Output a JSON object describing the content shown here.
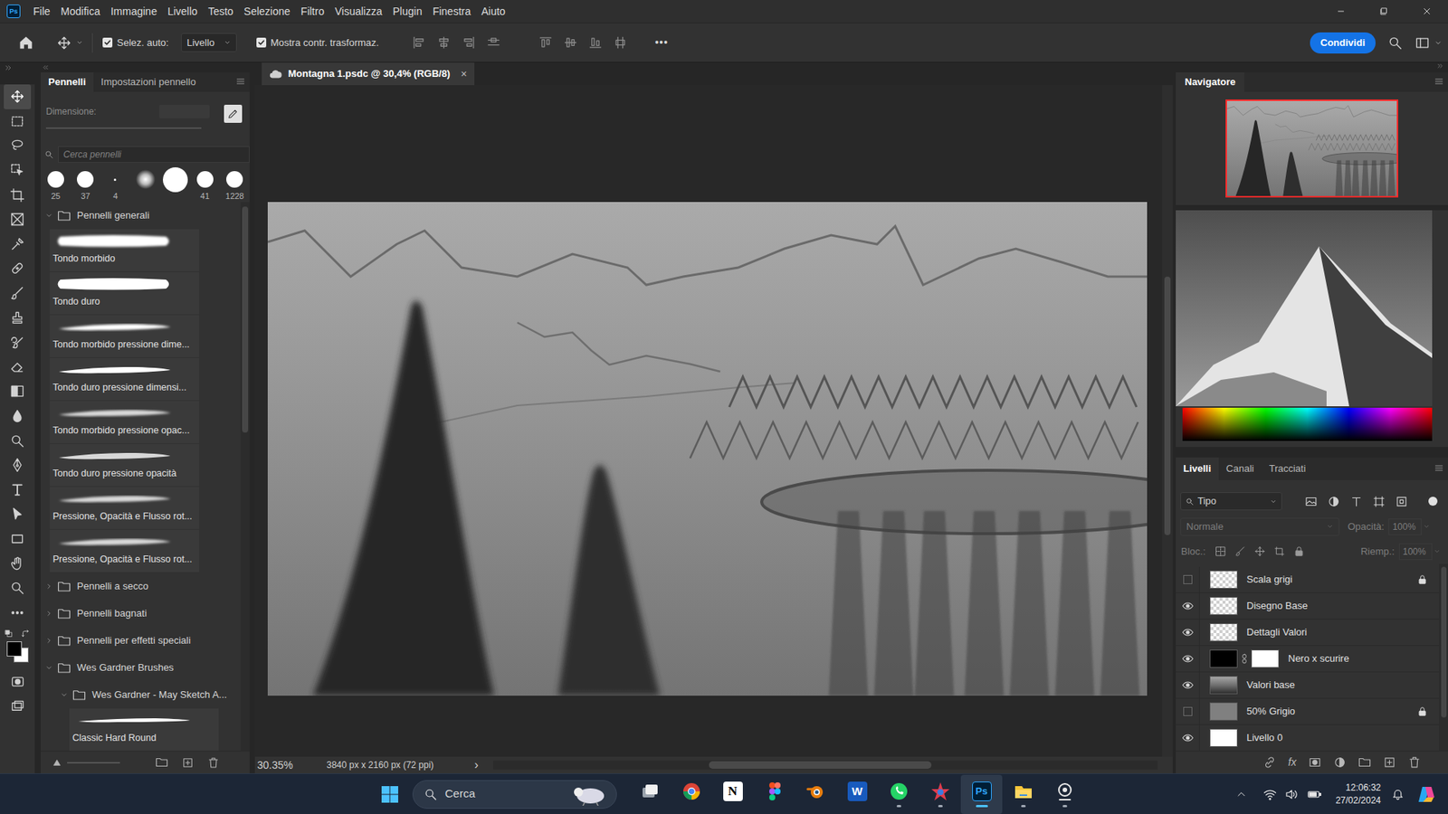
{
  "app": {
    "logo": "Ps"
  },
  "menu": [
    "File",
    "Modifica",
    "Immagine",
    "Livello",
    "Testo",
    "Selezione",
    "Filtro",
    "Visualizza",
    "Plugin",
    "Finestra",
    "Aiuto"
  ],
  "options_bar": {
    "auto_select": {
      "label": "Selez. auto:",
      "checked": true
    },
    "target": "Livello",
    "show_transform": {
      "label": "Mostra contr. trasformaz.",
      "checked": true
    },
    "more": "•••",
    "share": "Condividi"
  },
  "tools": [
    {
      "kind": "move",
      "selected": true
    },
    {
      "kind": "marquee",
      "selected": false
    },
    {
      "kind": "lasso",
      "selected": false
    },
    {
      "kind": "objselect",
      "selected": false
    },
    {
      "kind": "crop",
      "selected": false
    },
    {
      "kind": "frame",
      "selected": false
    },
    {
      "kind": "eyedropper",
      "selected": false
    },
    {
      "kind": "heal",
      "selected": false
    },
    {
      "kind": "brush",
      "selected": false
    },
    {
      "kind": "stamp",
      "selected": false
    },
    {
      "kind": "historybrush",
      "selected": false
    },
    {
      "kind": "eraser",
      "selected": false
    },
    {
      "kind": "gradient",
      "selected": false
    },
    {
      "kind": "blur",
      "selected": false
    },
    {
      "kind": "dodge",
      "selected": false
    },
    {
      "kind": "pen",
      "selected": false
    },
    {
      "kind": "type",
      "selected": false
    },
    {
      "kind": "pathselect",
      "selected": false
    },
    {
      "kind": "rect",
      "selected": false
    },
    {
      "kind": "hand",
      "selected": false
    },
    {
      "kind": "zoom",
      "selected": false
    },
    {
      "kind": "more",
      "selected": false
    }
  ],
  "brushes_panel": {
    "tabs": [
      {
        "label": "Pennelli",
        "selected": true
      },
      {
        "label": "Impostazioni pennello",
        "selected": false
      }
    ],
    "size_label": "Dimensione:",
    "search_placeholder": "Cerca pennelli",
    "presets": [
      {
        "size": "25",
        "kind": "hard"
      },
      {
        "size": "37",
        "kind": "hard"
      },
      {
        "size": "4",
        "kind": "dot"
      },
      {
        "size": "",
        "kind": "soft"
      },
      {
        "size": "",
        "kind": "large"
      },
      {
        "size": "41",
        "kind": "hard"
      },
      {
        "size": "1228",
        "kind": "hard"
      }
    ],
    "tree": [
      {
        "kind": "folder",
        "name": "Pennelli generali",
        "expanded": true,
        "depth": 0
      },
      {
        "kind": "brush",
        "name": "Tondo morbido",
        "stroke": "soft",
        "depth": 1
      },
      {
        "kind": "brush",
        "name": "Tondo duro",
        "stroke": "hard",
        "depth": 1
      },
      {
        "kind": "brush",
        "name": "Tondo morbido pressione dime...",
        "stroke": "soft-taper",
        "depth": 1
      },
      {
        "kind": "brush",
        "name": "Tondo duro pressione dimensi...",
        "stroke": "hard-taper",
        "depth": 1
      },
      {
        "kind": "brush",
        "name": "Tondo morbido pressione opac...",
        "stroke": "soft-fade",
        "depth": 1
      },
      {
        "kind": "brush",
        "name": "Tondo duro pressione opacità",
        "stroke": "hard-fade",
        "depth": 1
      },
      {
        "kind": "brush",
        "name": "Pressione, Opacità e Flusso rot...",
        "stroke": "pressure",
        "depth": 1
      },
      {
        "kind": "brush",
        "name": "Pressione, Opacità e Flusso rot...",
        "stroke": "pressure",
        "depth": 1
      },
      {
        "kind": "folder",
        "name": "Pennelli a secco",
        "expanded": false,
        "depth": 0
      },
      {
        "kind": "folder",
        "name": "Pennelli bagnati",
        "expanded": false,
        "depth": 0
      },
      {
        "kind": "folder",
        "name": "Pennelli per effetti speciali",
        "expanded": false,
        "depth": 0
      },
      {
        "kind": "folder",
        "name": "Wes Gardner Brushes",
        "expanded": true,
        "depth": 0
      },
      {
        "kind": "folder",
        "name": "Wes Gardner - May Sketch A...",
        "expanded": true,
        "depth": 1
      },
      {
        "kind": "brush",
        "name": "Classic Hard Round",
        "stroke": "hard-thin",
        "depth": 2
      }
    ]
  },
  "document": {
    "tab": "Montagna 1.psdc @ 30,4% (RGB/8)",
    "close": "×",
    "zoom": "30.35%",
    "info": "3840 px x 2160 px (72 ppi)",
    "arrow": "›"
  },
  "navigator": {
    "title": "Navigatore"
  },
  "layers_panel": {
    "tabs": [
      {
        "label": "Livelli",
        "selected": true
      },
      {
        "label": "Canali",
        "selected": false
      },
      {
        "label": "Tracciati",
        "selected": false
      }
    ],
    "filter": "Tipo",
    "controls_disabled": true,
    "blend": "Normale",
    "opacity_label": "Opacità:",
    "opacity": "100%",
    "lock_label": "Bloc.:",
    "fill_label": "Riemp.:",
    "fill": "100%",
    "fx": "fx",
    "layers": [
      {
        "name": "Scala grigi",
        "visible": false,
        "locked": true,
        "kind": "transparent"
      },
      {
        "name": "Disegno Base",
        "visible": true,
        "locked": false,
        "kind": "transparent"
      },
      {
        "name": "Dettagli Valori",
        "visible": true,
        "locked": false,
        "kind": "transparent"
      },
      {
        "name": "Nero x scurire",
        "visible": true,
        "locked": false,
        "kind": "mask"
      },
      {
        "name": "Valori base",
        "visible": true,
        "locked": false,
        "kind": "image"
      },
      {
        "name": "50% Grigio",
        "visible": false,
        "locked": true,
        "kind": "gray"
      },
      {
        "name": "Livello 0",
        "visible": true,
        "locked": false,
        "kind": "white"
      }
    ]
  },
  "taskbar": {
    "search": "Cerca",
    "apps": [
      {
        "kind": "taskview",
        "label": "",
        "running": false,
        "active": false
      },
      {
        "kind": "chrome",
        "label": "",
        "running": false,
        "active": false
      },
      {
        "kind": "notion",
        "label": "N",
        "running": false,
        "active": false
      },
      {
        "kind": "figma",
        "label": "",
        "running": false,
        "active": false
      },
      {
        "kind": "blender",
        "label": "",
        "running": false,
        "active": false
      },
      {
        "kind": "word",
        "label": "W",
        "running": false,
        "active": false
      },
      {
        "kind": "whatsapp",
        "label": "",
        "running": true,
        "active": false
      },
      {
        "kind": "star",
        "label": "",
        "running": true,
        "active": false
      },
      {
        "kind": "photoshop",
        "label": "Ps",
        "running": true,
        "active": true
      },
      {
        "kind": "explorer",
        "label": "",
        "running": true,
        "active": false
      },
      {
        "kind": "camera",
        "label": "",
        "running": true,
        "active": false
      }
    ],
    "time": "12:06:32",
    "date": "27/02/2024"
  }
}
